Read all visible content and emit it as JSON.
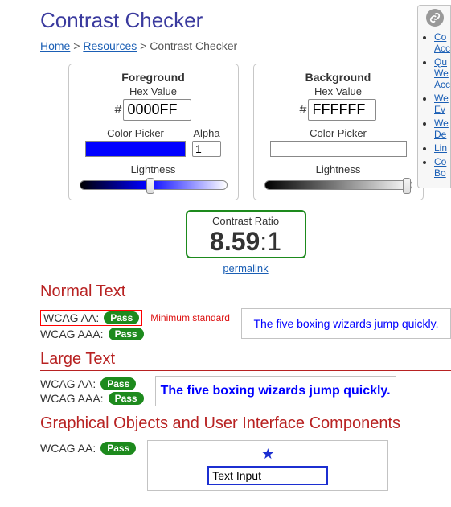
{
  "title": "Contrast Checker",
  "breadcrumb": {
    "home": "Home",
    "sep": ">",
    "resources": "Resources",
    "current": "Contrast Checker"
  },
  "fg": {
    "title": "Foreground",
    "hex_label": "Hex Value",
    "hex_value": "0000FF",
    "picker_label": "Color Picker",
    "alpha_label": "Alpha",
    "alpha_value": "1",
    "lightness_label": "Lightness"
  },
  "bg": {
    "title": "Background",
    "hex_label": "Hex Value",
    "hex_value": "FFFFFF",
    "picker_label": "Color Picker",
    "lightness_label": "Lightness"
  },
  "ratio": {
    "label": "Contrast Ratio",
    "value": "8.59",
    "suffix": ":1",
    "permalink": "permalink"
  },
  "normal": {
    "heading": "Normal Text",
    "aa_label": "WCAG AA:",
    "aa_badge": "Pass",
    "aaa_label": "WCAG AAA:",
    "aaa_badge": "Pass",
    "min_std": "Minimum standard",
    "sample": "The five boxing wizards jump quickly."
  },
  "large": {
    "heading": "Large Text",
    "aa_label": "WCAG AA:",
    "aa_badge": "Pass",
    "aaa_label": "WCAG AAA:",
    "aaa_badge": "Pass",
    "sample": "The five boxing wizards jump quickly."
  },
  "ui": {
    "heading": "Graphical Objects and User Interface Components",
    "aa_label": "WCAG AA:",
    "aa_badge": "Pass",
    "input_value": "Text Input"
  },
  "side": {
    "items": [
      {
        "l1": "Co",
        "l2": "Acc"
      },
      {
        "l1": "Qu",
        "l2": "We",
        "l3": "Acc"
      },
      {
        "l1": "We",
        "l2": "Ev"
      },
      {
        "l1": "We",
        "l2": "De"
      },
      {
        "l1": "Lin"
      },
      {
        "l1": "Co",
        "l2": "Bo"
      }
    ]
  }
}
